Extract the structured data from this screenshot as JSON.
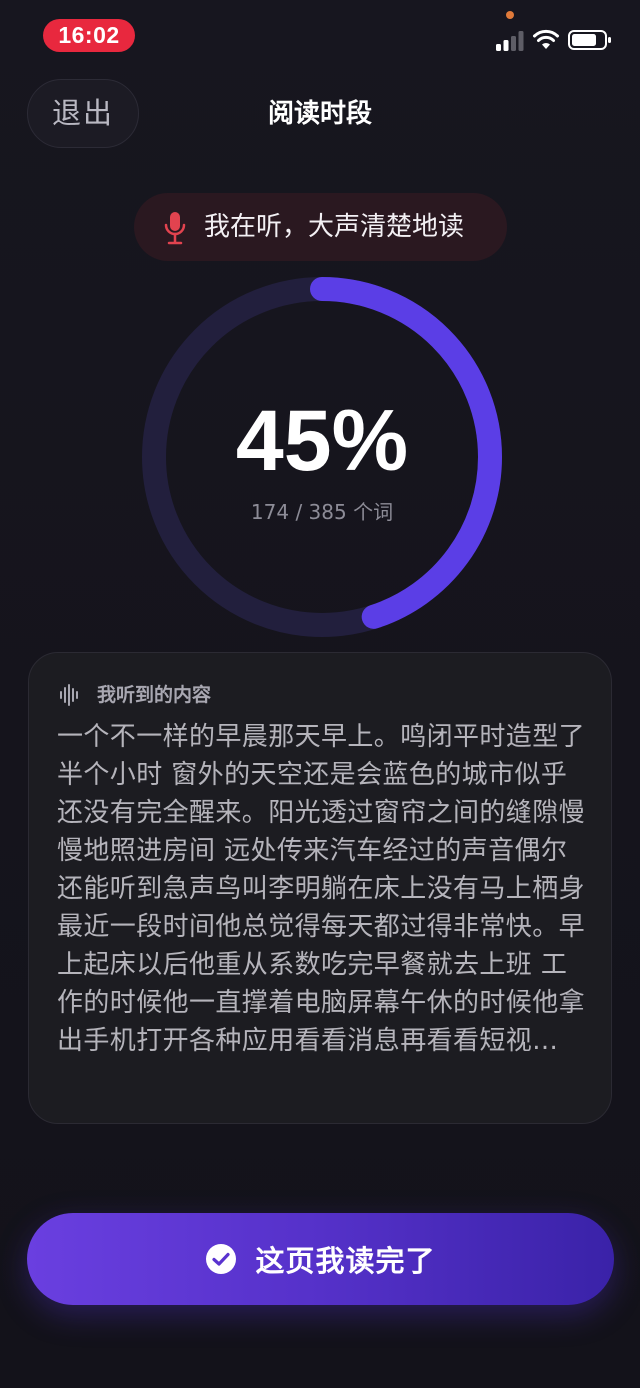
{
  "status_bar": {
    "time": "16:02",
    "signal_icon": "cellular-signal-icon",
    "wifi_icon": "wifi-icon",
    "battery_icon": "battery-icon"
  },
  "header": {
    "exit_label": "退出",
    "title": "阅读时段"
  },
  "listening": {
    "icon": "microphone-icon",
    "text": "我在听，大声清楚地读"
  },
  "progress": {
    "percent_label": "45%",
    "fraction": 0.45,
    "word_count_label": "174 / 385 个词"
  },
  "transcript": {
    "icon": "waveform-icon",
    "heading": "我听到的内容",
    "text": "一个不一样的早晨那天早上。鸣闭平时造型了半个小时 窗外的天空还是会蓝色的城市似乎还没有完全醒来。阳光透过窗帘之间的缝隙慢慢地照进房间 远处传来汽车经过的声音偶尔还能听到急声鸟叫李明躺在床上没有马上栖身 最近一段时间他总觉得每天都过得非常快。早上起床以后他重从系数吃完早餐就去上班 工作的时候他一直撑着电脑屏幕午休的时候他拿出手机打开各种应用看看消息再看看短视..."
  },
  "done_button": {
    "icon": "check-circle-icon",
    "label": "这页我读完了"
  },
  "colors": {
    "accent": "#5b3ee6",
    "ring_track": "#221f3d",
    "status_red": "#e8283e",
    "mic_red": "#e2434f"
  }
}
